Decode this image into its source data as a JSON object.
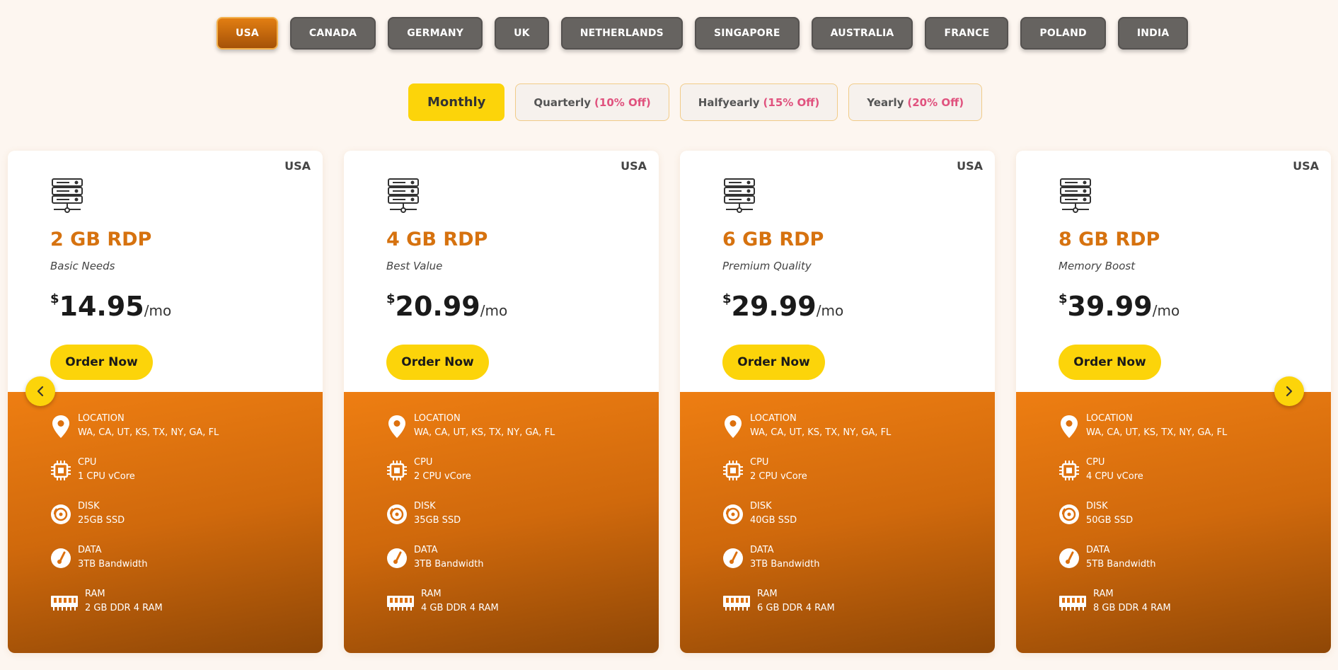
{
  "countries": [
    "USA",
    "CANADA",
    "GERMANY",
    "UK",
    "NETHERLANDS",
    "SINGAPORE",
    "AUSTRALIA",
    "FRANCE",
    "POLAND",
    "INDIA"
  ],
  "active_country": "USA",
  "billing": [
    {
      "label": "Monthly",
      "discount": ""
    },
    {
      "label": "Quarterly",
      "discount": "(10% Off)"
    },
    {
      "label": "Halfyearly",
      "discount": "(15% Off)"
    },
    {
      "label": "Yearly",
      "discount": "(20% Off)"
    }
  ],
  "plans": [
    {
      "country": "USA",
      "name": "2 GB RDP",
      "tagline": "Basic Needs",
      "currency": "$",
      "price": "14.95",
      "period": "/mo",
      "order_label": "Order Now",
      "specs": [
        {
          "icon": "location-pin-icon",
          "label": "LOCATION",
          "value": "WA, CA, UT, KS, TX, NY, GA, FL"
        },
        {
          "icon": "cpu-icon",
          "label": "CPU",
          "value": "1 CPU vCore"
        },
        {
          "icon": "disk-icon",
          "label": "DISK",
          "value": "25GB SSD"
        },
        {
          "icon": "gauge-icon",
          "label": "DATA",
          "value": "3TB Bandwidth"
        },
        {
          "icon": "ram-icon",
          "label": "RAM",
          "value": "2 GB DDR 4 RAM"
        }
      ]
    },
    {
      "country": "USA",
      "name": "4 GB RDP",
      "tagline": "Best Value",
      "currency": "$",
      "price": "20.99",
      "period": "/mo",
      "order_label": "Order Now",
      "specs": [
        {
          "icon": "location-pin-icon",
          "label": "LOCATION",
          "value": "WA, CA, UT, KS, TX, NY, GA, FL"
        },
        {
          "icon": "cpu-icon",
          "label": "CPU",
          "value": "2 CPU vCore"
        },
        {
          "icon": "disk-icon",
          "label": "DISK",
          "value": "35GB SSD"
        },
        {
          "icon": "gauge-icon",
          "label": "DATA",
          "value": "3TB Bandwidth"
        },
        {
          "icon": "ram-icon",
          "label": "RAM",
          "value": "4 GB DDR 4 RAM"
        }
      ]
    },
    {
      "country": "USA",
      "name": "6 GB RDP",
      "tagline": "Premium Quality",
      "currency": "$",
      "price": "29.99",
      "period": "/mo",
      "order_label": "Order Now",
      "specs": [
        {
          "icon": "location-pin-icon",
          "label": "LOCATION",
          "value": "WA, CA, UT, KS, TX, NY, GA, FL"
        },
        {
          "icon": "cpu-icon",
          "label": "CPU",
          "value": "2 CPU vCore"
        },
        {
          "icon": "disk-icon",
          "label": "DISK",
          "value": "40GB SSD"
        },
        {
          "icon": "gauge-icon",
          "label": "DATA",
          "value": "3TB Bandwidth"
        },
        {
          "icon": "ram-icon",
          "label": "RAM",
          "value": "6 GB DDR 4 RAM"
        }
      ]
    },
    {
      "country": "USA",
      "name": "8 GB RDP",
      "tagline": "Memory Boost",
      "currency": "$",
      "price": "39.99",
      "period": "/mo",
      "order_label": "Order Now",
      "specs": [
        {
          "icon": "location-pin-icon",
          "label": "LOCATION",
          "value": "WA, CA, UT, KS, TX, NY, GA, FL"
        },
        {
          "icon": "cpu-icon",
          "label": "CPU",
          "value": "4 CPU vCore"
        },
        {
          "icon": "disk-icon",
          "label": "DISK",
          "value": "50GB SSD"
        },
        {
          "icon": "gauge-icon",
          "label": "DATA",
          "value": "5TB Bandwidth"
        },
        {
          "icon": "ram-icon",
          "label": "RAM",
          "value": "8 GB DDR 4 RAM"
        }
      ]
    }
  ],
  "colors": {
    "accent_orange": "#d6720f",
    "button_yellow": "#fcd40a",
    "discount_pink": "#e0527e",
    "tab_grey": "#666360"
  }
}
